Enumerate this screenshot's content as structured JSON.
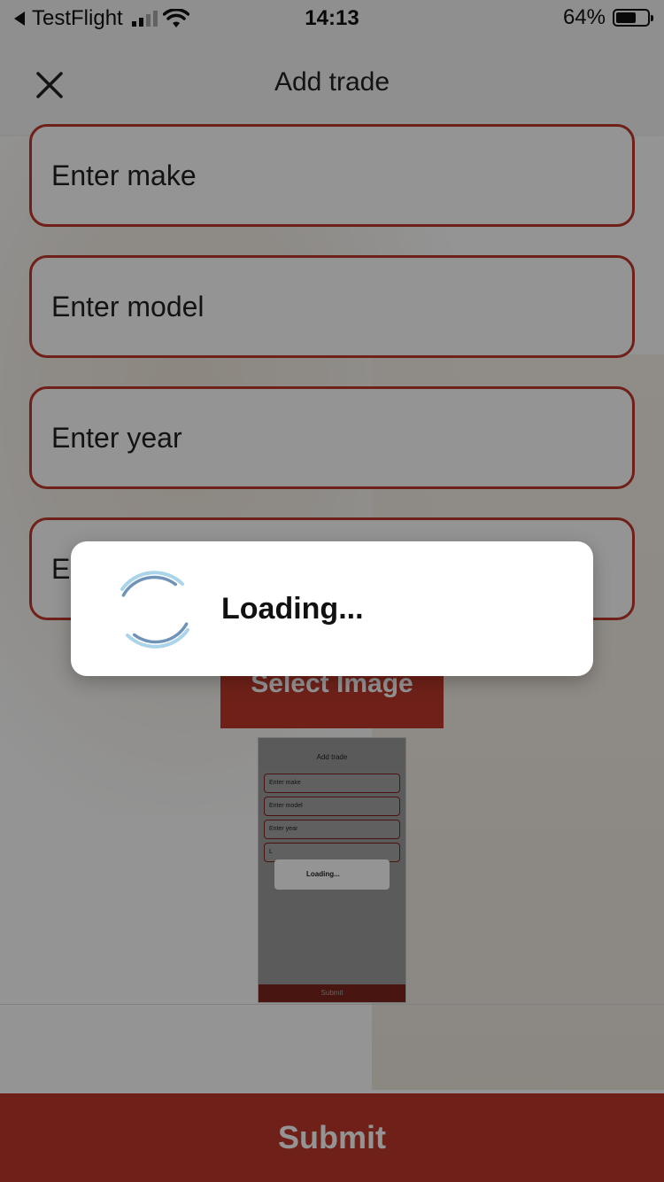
{
  "status_bar": {
    "back_app": "TestFlight",
    "time": "14:13",
    "battery_percent": "64%",
    "battery_level": 0.64
  },
  "header": {
    "title": "Add trade"
  },
  "form": {
    "make_placeholder": "Enter make",
    "model_placeholder": "Enter model",
    "year_placeholder": "Enter year",
    "fourth_placeholder": "Enter",
    "select_image_label": "Select Image"
  },
  "thumbnail": {
    "title": "Add trade",
    "fields": [
      "Enter make",
      "Enter model",
      "Enter year",
      "L"
    ],
    "loading": "Loading...",
    "submit": "Submit"
  },
  "footer": {
    "submit_label": "Submit"
  },
  "loading_dialog": {
    "text": "Loading..."
  },
  "colors": {
    "accent": "#c0392b",
    "overlay": "rgba(0,0,0,0.42)"
  },
  "icons": [
    "back-arrow-icon",
    "cellular-signal-icon",
    "wifi-icon",
    "battery-icon",
    "close-icon",
    "loading-spinner-icon"
  ]
}
